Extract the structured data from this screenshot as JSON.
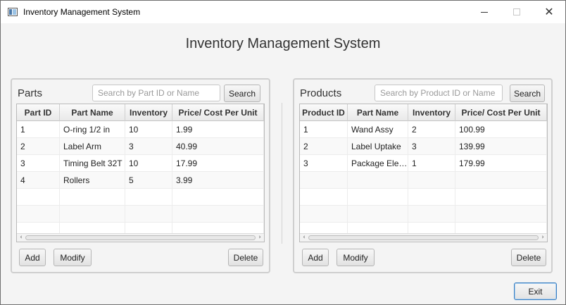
{
  "window": {
    "title": "Inventory Management System"
  },
  "main": {
    "title": "Inventory Management System"
  },
  "parts": {
    "title": "Parts",
    "search_placeholder": "Search by Part ID or Name",
    "search_label": "Search",
    "columns": [
      "Part ID",
      "Part Name",
      "Inventory",
      "Price/ Cost Per Unit"
    ],
    "rows": [
      [
        "1",
        "O-ring 1/2 in",
        "10",
        "1.99"
      ],
      [
        "2",
        "Label Arm",
        "3",
        "40.99"
      ],
      [
        "3",
        "Timing Belt 32T",
        "10",
        "17.99"
      ],
      [
        "4",
        "Rollers",
        "5",
        "3.99"
      ]
    ],
    "add_label": "Add",
    "modify_label": "Modify",
    "delete_label": "Delete"
  },
  "products": {
    "title": "Products",
    "search_placeholder": "Search by Product ID or Name",
    "search_label": "Search",
    "columns": [
      "Product ID",
      "Part Name",
      "Inventory",
      "Price/ Cost Per Unit"
    ],
    "rows": [
      [
        "1",
        "Wand Assy",
        "2",
        "100.99"
      ],
      [
        "2",
        "Label Uptake",
        "3",
        "139.99"
      ],
      [
        "3",
        "Package Elev...",
        "1",
        "179.99"
      ]
    ],
    "add_label": "Add",
    "modify_label": "Modify",
    "delete_label": "Delete"
  },
  "footer": {
    "exit_label": "Exit"
  }
}
